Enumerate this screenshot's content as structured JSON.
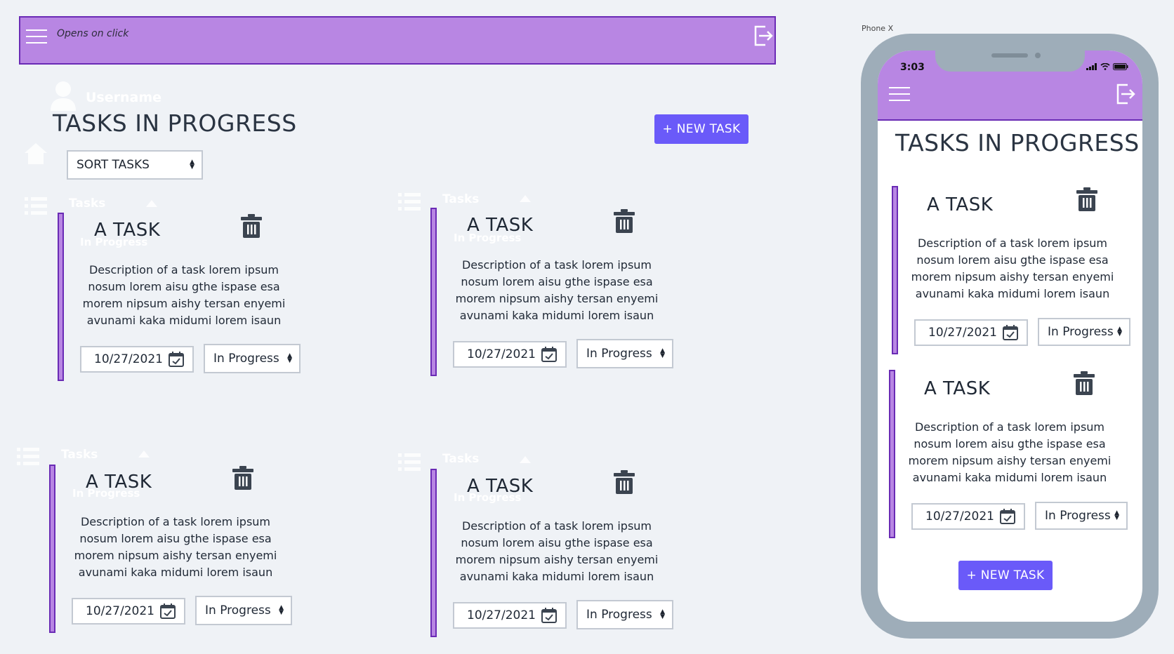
{
  "colors": {
    "accent": "#b886e3",
    "accent_border": "#6a2bb5",
    "button": "#6a5af9",
    "background": "#eff2f6"
  },
  "header": {
    "menu_icon": "hamburger-icon",
    "note": "Opens on click",
    "logout_icon": "exit-icon"
  },
  "sidebar_ghost": {
    "username": "Username",
    "user_icon": "user-icon",
    "home_icon": "home-icon",
    "tasks_label": "Tasks",
    "in_progress_label": "In Progress"
  },
  "main": {
    "title": "TASKS IN PROGRESS",
    "new_task_label": "+ NEW TASK",
    "sort_label": "SORT TASKS"
  },
  "tasks": [
    {
      "title": "A TASK",
      "description": "Description of a task lorem ipsum nosum lorem aisu gthe ispase esa morem nipsum aishy tersan enyemi avunami kaka midumi lorem isaun",
      "date": "10/27/2021",
      "status": "In Progress"
    },
    {
      "title": "A TASK",
      "description": "Description of a task lorem ipsum nosum lorem aisu gthe ispase esa morem nipsum aishy tersan enyemi avunami kaka midumi lorem isaun",
      "date": "10/27/2021",
      "status": "In Progress"
    },
    {
      "title": "A TASK",
      "description": "Description of a task lorem ipsum nosum lorem aisu gthe ispase esa morem nipsum aishy tersan enyemi avunami kaka midumi lorem isaun",
      "date": "10/27/2021",
      "status": "In Progress"
    },
    {
      "title": "A TASK",
      "description": "Description of a task lorem ipsum nosum lorem aisu gthe ispase esa morem nipsum aishy tersan enyemi avunami kaka midumi lorem isaun",
      "date": "10/27/2021",
      "status": "In Progress"
    }
  ],
  "phone": {
    "device_label": "Phone X",
    "time": "3:03",
    "title": "TASKS IN PROGRESS",
    "new_task_label": "+ NEW TASK",
    "tasks": [
      {
        "title": "A TASK",
        "description": "Description of a task lorem ipsum nosum lorem aisu gthe ispase esa morem nipsum aishy tersan enyemi avunami kaka midumi lorem isaun",
        "date": "10/27/2021",
        "status": "In Progress"
      },
      {
        "title": "A TASK",
        "description": "Description of a task lorem ipsum nosum lorem aisu gthe ispase esa morem nipsum aishy tersan enyemi avunami kaka midumi lorem isaun",
        "date": "10/27/2021",
        "status": "In Progress"
      }
    ]
  }
}
